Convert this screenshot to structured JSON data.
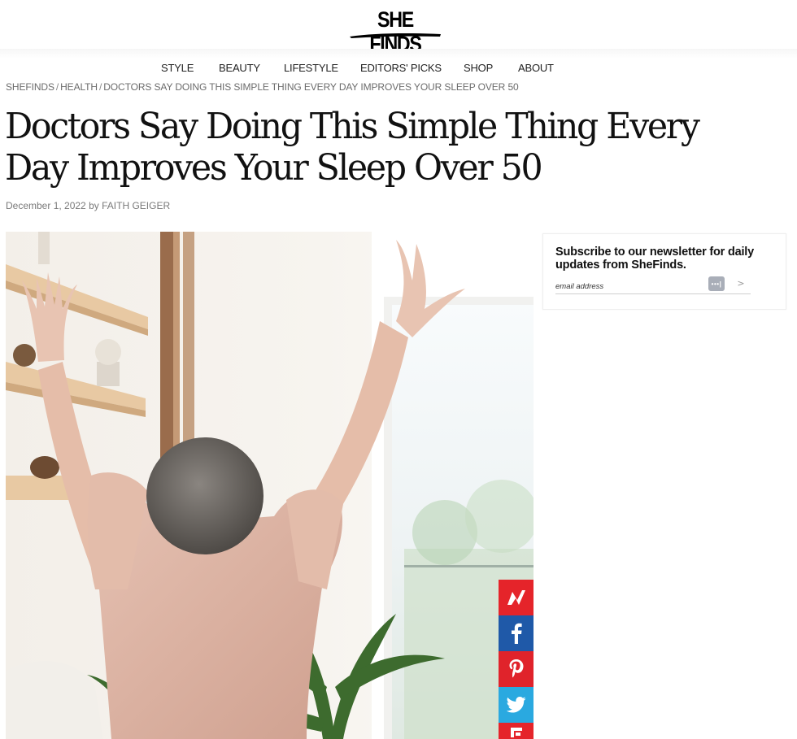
{
  "brand": {
    "logo_text": "SHE FINDS"
  },
  "nav": {
    "items": [
      {
        "label": "STYLE"
      },
      {
        "label": "BEAUTY"
      },
      {
        "label": "LIFESTYLE"
      },
      {
        "label": "EDITORS' PICKS"
      },
      {
        "label": "SHOP"
      },
      {
        "label": "ABOUT"
      }
    ]
  },
  "breadcrumb": {
    "items": [
      {
        "label": "SHEFINDS"
      },
      {
        "label": "HEALTH"
      },
      {
        "label": "DOCTORS SAY DOING THIS SIMPLE THING EVERY DAY IMPROVES YOUR SLEEP OVER 50"
      }
    ],
    "separator": "/"
  },
  "article": {
    "title": "Doctors Say Doing This Simple Thing Every Day Improves Your Sleep Over 50",
    "date": "December 1, 2022",
    "by": "by",
    "author": "FAITH GEIGER"
  },
  "newsletter": {
    "heading": "Subscribe to our newsletter for daily updates from SheFinds.",
    "placeholder": "email address",
    "key_badge": "•••|",
    "submit_label": ">"
  },
  "share": {
    "icons": [
      "flipboard-icon",
      "facebook-icon",
      "pinterest-icon",
      "twitter-icon",
      "more-share-icon"
    ]
  },
  "colors": {
    "flipboard": "#e5242a",
    "facebook": "#1f59a8",
    "pinterest": "#e0232b",
    "twitter": "#2aa9e0"
  }
}
